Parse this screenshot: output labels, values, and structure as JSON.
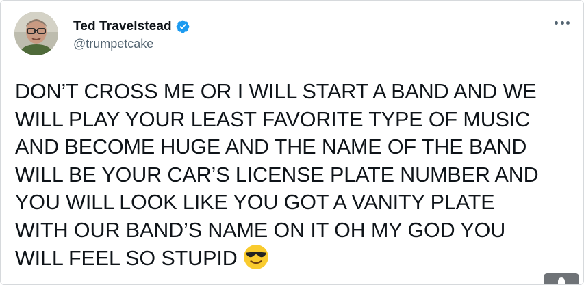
{
  "tweet": {
    "author": {
      "display_name": "Ted Travelstead",
      "handle": "@trumpetcake",
      "verified": true,
      "verified_color": "#1d9bf0"
    },
    "more_icon": "more-horizontal-icon",
    "text": "DON’T CROSS ME OR I WILL START A BAND AND WE\nWILL PLAY YOUR LEAST FAVORITE TYPE OF MUSIC\nAND BECOME HUGE AND THE NAME OF THE BAND\nWILL BE YOUR CAR’S LICENSE PLATE NUMBER AND\nYOU WILL LOOK LIKE YOU GOT A VANITY PLATE\nWITH OUR BAND’S NAME ON IT OH MY GOD YOU\nWILL FEEL SO STUPID",
    "emoji": "smiling-face-with-sunglasses"
  },
  "colors": {
    "text_primary": "#0f1419",
    "text_secondary": "#536471",
    "border": "#d6d9dc"
  }
}
